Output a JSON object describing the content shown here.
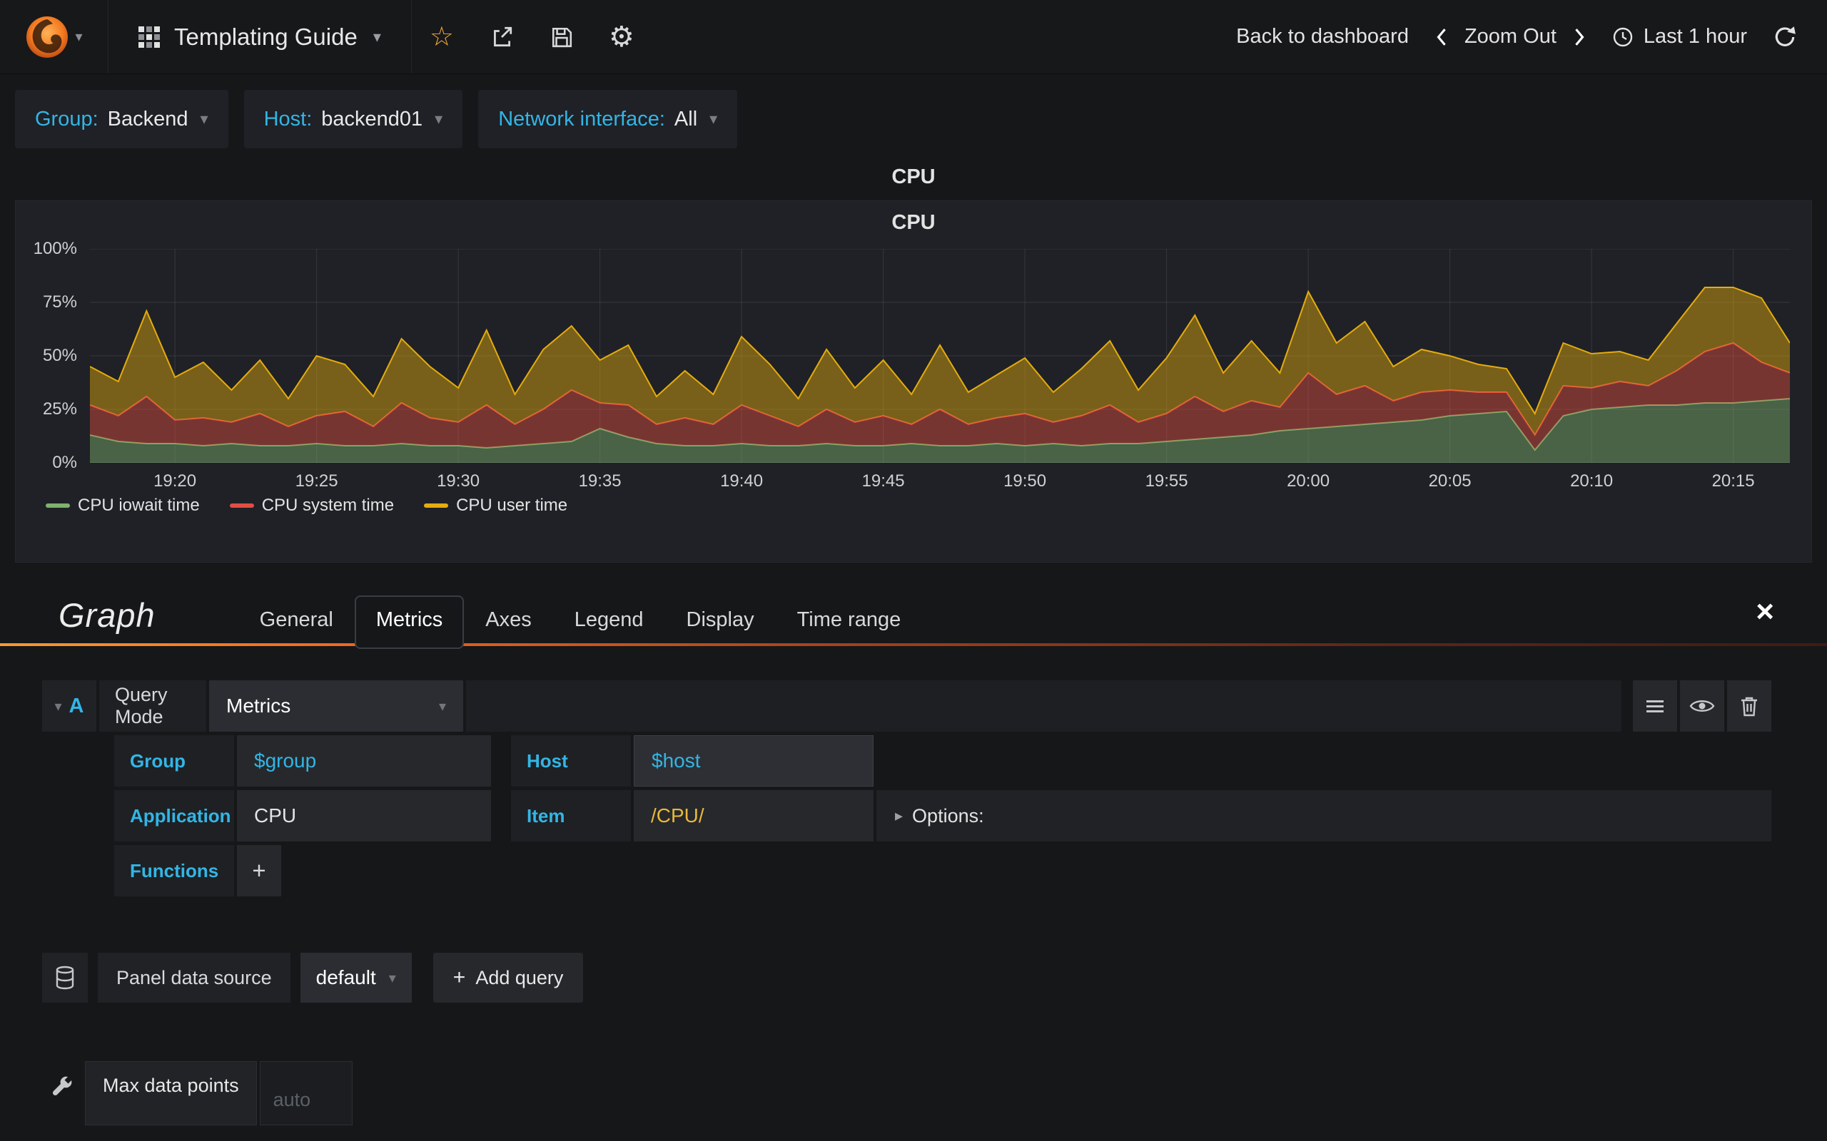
{
  "icons": {
    "caret_down": "▾",
    "caret_right": "▸",
    "star": "☆",
    "gear": "⚙",
    "plus": "+",
    "close": "×"
  },
  "navbar": {
    "dashboard_title": "Templating Guide",
    "back_to_dashboard": "Back to dashboard",
    "zoom_out": "Zoom Out",
    "time_range": "Last 1 hour"
  },
  "template_vars": [
    {
      "label": "Group:",
      "value": "Backend"
    },
    {
      "label": "Host:",
      "value": "backend01"
    },
    {
      "label": "Network interface:",
      "value": "All"
    }
  ],
  "row_title": "CPU",
  "panel_title": "CPU",
  "chart_data": {
    "type": "area",
    "stacked": true,
    "title": "CPU",
    "ylabel": "",
    "xlabel": "",
    "unit": "percent",
    "grid": true,
    "legend_position": "bottom-left",
    "ylim": [
      0,
      100
    ],
    "y_ticks": [
      0,
      25,
      50,
      75,
      100
    ],
    "y_tick_labels": [
      "0%",
      "25%",
      "50%",
      "75%",
      "100%"
    ],
    "x_start": "19:17",
    "x_end": "20:17",
    "x_span_minutes": 60,
    "x_tick_minutes": [
      3,
      8,
      13,
      18,
      23,
      28,
      33,
      38,
      43,
      48,
      53,
      58
    ],
    "x_tick_labels": [
      "19:20",
      "19:25",
      "19:30",
      "19:35",
      "19:40",
      "19:45",
      "19:50",
      "19:55",
      "20:00",
      "20:05",
      "20:10",
      "20:15"
    ],
    "series": [
      {
        "name": "CPU iowait time",
        "color": "#7eb26d",
        "values": [
          13,
          10,
          9,
          9,
          8,
          9,
          8,
          8,
          9,
          8,
          8,
          9,
          8,
          8,
          7,
          8,
          9,
          10,
          16,
          12,
          9,
          8,
          8,
          9,
          8,
          8,
          9,
          8,
          8,
          9,
          8,
          8,
          9,
          8,
          9,
          8,
          9,
          9,
          10,
          11,
          12,
          13,
          15,
          16,
          17,
          18,
          19,
          20,
          22,
          23,
          24,
          6,
          22,
          25,
          26,
          27,
          27,
          28,
          28,
          29,
          30
        ]
      },
      {
        "name": "CPU system time",
        "color": "#e24d42",
        "values": [
          14,
          12,
          22,
          11,
          13,
          10,
          15,
          9,
          13,
          16,
          9,
          19,
          13,
          11,
          20,
          10,
          16,
          24,
          12,
          15,
          9,
          13,
          10,
          18,
          14,
          9,
          16,
          11,
          14,
          9,
          17,
          10,
          12,
          15,
          10,
          14,
          18,
          10,
          13,
          20,
          12,
          16,
          11,
          26,
          15,
          18,
          10,
          13,
          12,
          10,
          9,
          7,
          14,
          10,
          12,
          9,
          16,
          24,
          28,
          18,
          12
        ]
      },
      {
        "name": "CPU user time",
        "color": "#e5ac0e",
        "values": [
          18,
          16,
          40,
          20,
          26,
          15,
          25,
          13,
          28,
          22,
          14,
          30,
          24,
          16,
          35,
          14,
          28,
          30,
          20,
          28,
          13,
          22,
          14,
          32,
          24,
          13,
          28,
          16,
          26,
          14,
          30,
          15,
          20,
          26,
          14,
          22,
          30,
          15,
          26,
          38,
          18,
          28,
          16,
          38,
          24,
          30,
          16,
          20,
          16,
          13,
          11,
          10,
          20,
          16,
          14,
          12,
          22,
          30,
          26,
          30,
          14
        ]
      }
    ]
  },
  "editor": {
    "panel_type": "Graph",
    "tabs": [
      "General",
      "Metrics",
      "Axes",
      "Legend",
      "Display",
      "Time range"
    ],
    "active_tab": "Metrics",
    "query": {
      "letter": "A",
      "mode_label": "Query Mode",
      "mode_value": "Metrics",
      "group_label": "Group",
      "group_value": "$group",
      "host_label": "Host",
      "host_value": "$host",
      "application_label": "Application",
      "application_value": "CPU",
      "item_label": "Item",
      "item_value": "/CPU/",
      "options_label": "Options:",
      "functions_label": "Functions"
    },
    "datasource_label": "Panel data source",
    "datasource_value": "default",
    "add_query_label": "Add query",
    "max_data_points_label": "Max data points",
    "max_data_points_placeholder": "auto"
  }
}
